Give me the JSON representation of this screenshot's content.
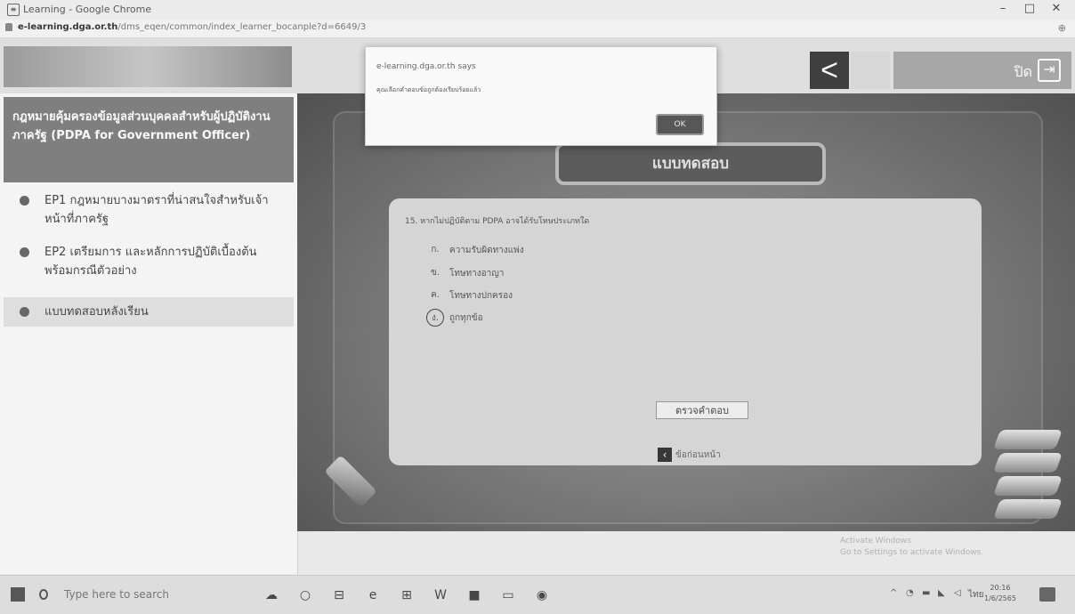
{
  "browser": {
    "window_title": "Learning - Google Chrome",
    "url_host": "e-learning.dga.or.th",
    "url_path": "/dms_eqen/common/index_learner_bocanple?d=6649/3",
    "controls": {
      "minimize": "–",
      "maximize": "□",
      "close": "✕"
    },
    "zoom_icon": "⊕"
  },
  "header": {
    "back_label": "<",
    "close_label": "ปิด",
    "close_icon": "⇥"
  },
  "sidebar": {
    "course_title": "กฎหมายคุ้มครองข้อมูลส่วนบุคคลสำหรับผู้ปฏิบัติงานภาครัฐ (PDPA for Government Officer)",
    "items": [
      {
        "label": "EP1 กฎหมายบางมาตราที่น่าสนใจสำหรับเจ้าหน้าที่ภาครัฐ",
        "active": false
      },
      {
        "label": "EP2 เตรียมการ และหลักการปฏิบัติเบื้องต้นพร้อมกรณีตัวอย่าง",
        "active": false
      },
      {
        "label": "แบบทดสอบหลังเรียน",
        "active": true
      }
    ]
  },
  "quiz": {
    "banner": "แบบทดสอบ",
    "question": "15. หากไม่ปฏิบัติตาม PDPA อาจได้รับโทษประเภทใด",
    "options": [
      {
        "key": "ก.",
        "text": "ความรับผิดทางแพ่ง"
      },
      {
        "key": "ข.",
        "text": "โทษทางอาญา"
      },
      {
        "key": "ค.",
        "text": "โทษทางปกครอง"
      },
      {
        "key": "ง.",
        "text": "ถูกทุกข้อ"
      }
    ],
    "selected_index": 3,
    "check_button": "ตรวจคำตอบ",
    "prev_button": "ข้อก่อนหน้า"
  },
  "alert": {
    "origin": "e-learning.dga.or.th says",
    "message": "คุณเลือกคำตอบข้อถูกต้องเรียบร้อยแล้ว",
    "ok_label": "OK"
  },
  "watermark": {
    "line1": "Activate Windows",
    "line2": "Go to Settings to activate Windows."
  },
  "taskbar": {
    "search_placeholder": "Type here to search",
    "time": "20:16",
    "date": "1/6/2565",
    "lang": "ไทย"
  }
}
